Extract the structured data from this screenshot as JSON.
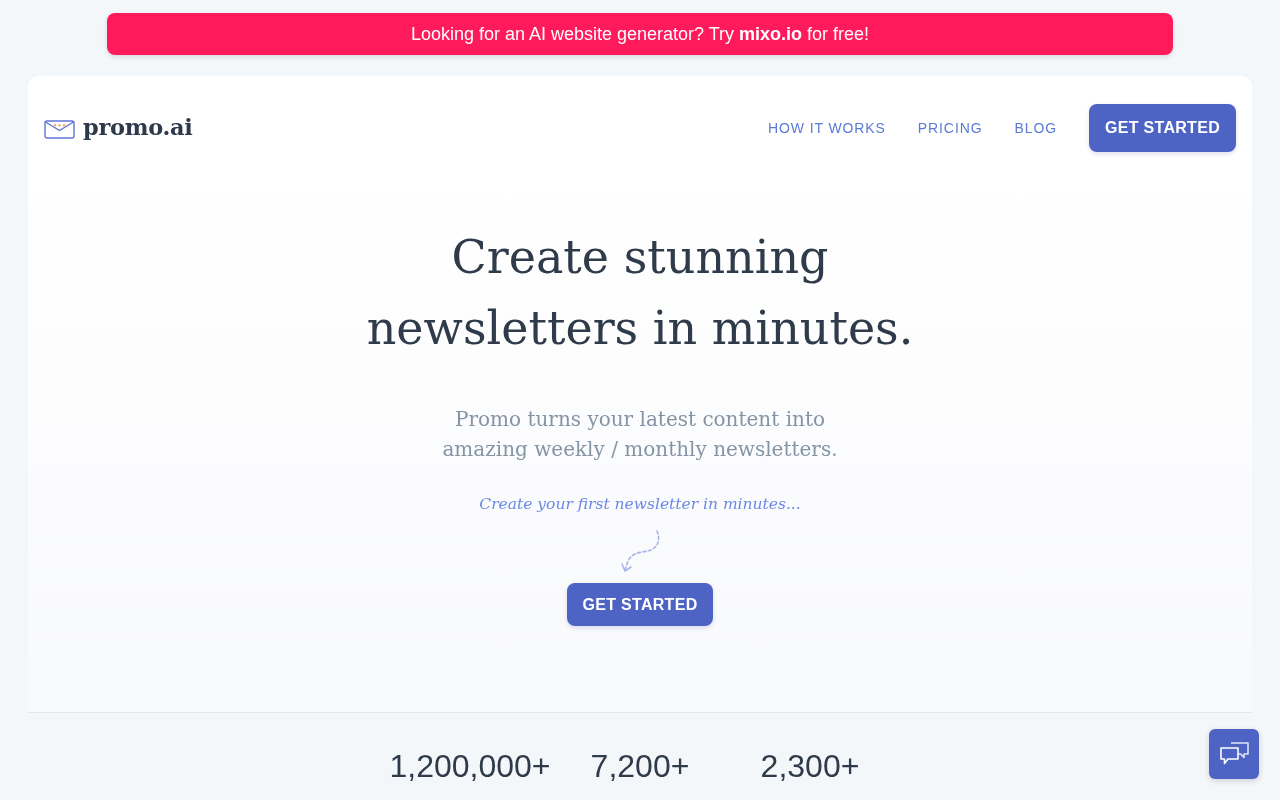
{
  "promo_banner": {
    "text": "Looking for an AI website generator? Try **mixo.io** for free!"
  },
  "navbar": {
    "logo": "promo.ai",
    "links": [
      "HOW IT WORKS",
      "PRICING",
      "BLOG"
    ],
    "cta": "GET STARTED"
  },
  "hero": {
    "heading_lines": [
      "Create stunning",
      "newsletters in minutes."
    ],
    "subtitle_lines": [
      "Promo turns your latest content into",
      "amazing weekly / monthly newsletters."
    ],
    "tagline": "Create your first newsletter in minutes...",
    "cta": "GET STARTED"
  },
  "stats": [
    {
      "value": "1,200,000+"
    },
    {
      "value": "7,200+"
    },
    {
      "value": "2,300+"
    }
  ]
}
